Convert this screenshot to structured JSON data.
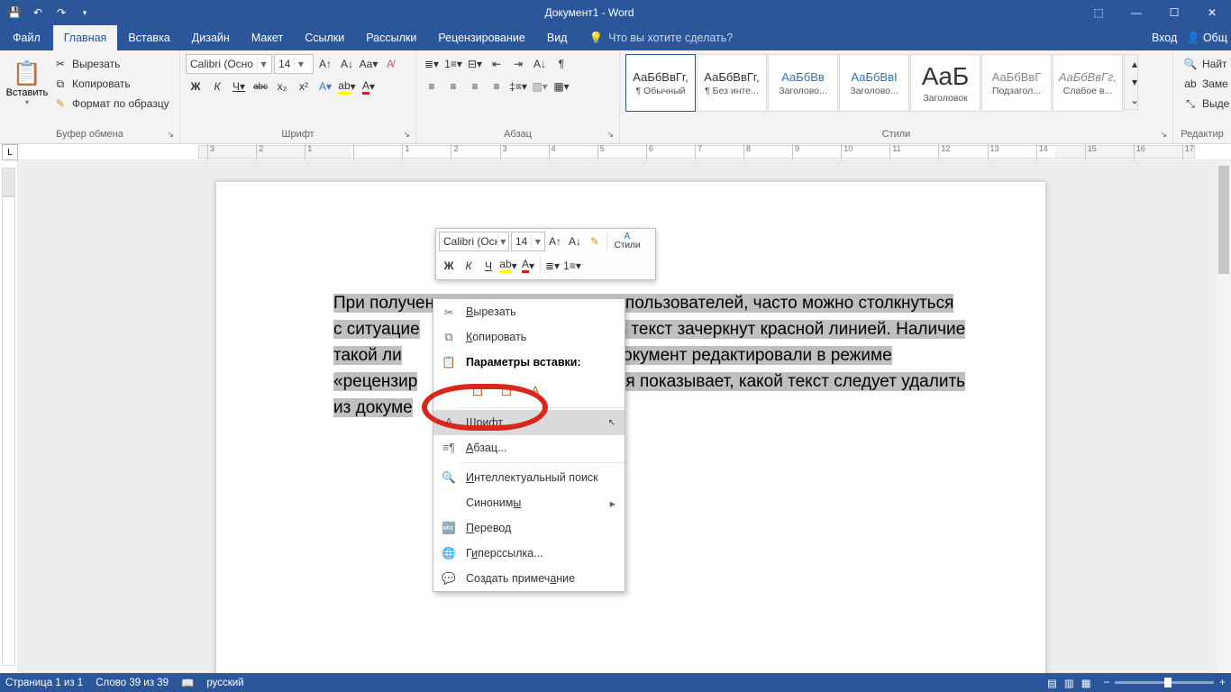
{
  "app": {
    "title": "Документ1 - Word"
  },
  "window_buttons": {
    "ribbon_opts": "⬚",
    "min": "—",
    "max": "☐",
    "close": "✕"
  },
  "menu": {
    "file": "Файл",
    "tabs": [
      "Главная",
      "Вставка",
      "Дизайн",
      "Макет",
      "Ссылки",
      "Рассылки",
      "Рецензирование",
      "Вид"
    ],
    "active": "Главная",
    "tellme_placeholder": "Что вы хотите сделать?",
    "signin": "Вход",
    "share": "Общ"
  },
  "ribbon": {
    "clipboard": {
      "paste": "Вставить",
      "cut": "Вырезать",
      "copy": "Копировать",
      "format_painter": "Формат по образцу",
      "label": "Буфер обмена"
    },
    "font": {
      "name": "Calibri (Осно",
      "size": "14",
      "bold": "Ж",
      "italic": "К",
      "underline": "Ч",
      "strike": "abc",
      "sub": "x₂",
      "sup": "x²",
      "label": "Шрифт"
    },
    "paragraph": {
      "label": "Абзац"
    },
    "styles": {
      "label": "Стили",
      "items": [
        {
          "preview": "АаБбВвГг,",
          "name": "¶ Обычный"
        },
        {
          "preview": "АаБбВвГг,",
          "name": "¶ Без инте..."
        },
        {
          "preview": "АаБбВв",
          "name": "Заголово...",
          "accent": true
        },
        {
          "preview": "АаБбВвI",
          "name": "Заголово...",
          "accent": true
        },
        {
          "preview": "АaБ",
          "name": "Заголовок",
          "big": true
        },
        {
          "preview": "АаБбВвГ",
          "name": "Подзагол...",
          "gray": true
        },
        {
          "preview": "АаБбВвГг,",
          "name": "Слабое в...",
          "gray": true
        }
      ]
    },
    "editing": {
      "find": "Найт",
      "replace": "Заме",
      "select": "Выде",
      "label": "Редактир"
    }
  },
  "ruler": {
    "marks": [
      "3",
      "2",
      "1",
      "",
      "1",
      "2",
      "3",
      "4",
      "5",
      "6",
      "7",
      "8",
      "9",
      "10",
      "11",
      "12",
      "13",
      "14",
      "15",
      "16",
      "17"
    ]
  },
  "document": {
    "lines": [
      {
        "pre": "",
        "sel": "При получении документа от других пользователей, часто можно столкнуться"
      },
      {
        "pre": "",
        "sel_left": "с ситуацие",
        "sel_right": "сь текст зачеркнут красной линией. Наличие"
      },
      {
        "pre": "",
        "sel_left": "такой    ли",
        "sel_right": "то    документ    редактировали    в    режиме"
      },
      {
        "pre": "",
        "sel_left": "«рецензир",
        "sel_right": "ния показывает, какой текст следует удалить"
      },
      {
        "pre": "",
        "sel": "из докуме"
      }
    ]
  },
  "minitoolbar": {
    "font": "Calibri (Осн",
    "size": "14",
    "styles": "Стили"
  },
  "context_menu": {
    "cut": "Вырезать",
    "copy": "Копировать",
    "paste_header": "Параметры вставки:",
    "font": "Шрифт...",
    "paragraph": "Абзац...",
    "smart_lookup": "Интеллектуальный поиск",
    "synonyms": "Синонимы",
    "translate": "Перевод",
    "hyperlink": "Гиперссылка...",
    "new_comment": "Создать примечание"
  },
  "statusbar": {
    "page": "Страница 1 из 1",
    "words": "Слово 39 из 39",
    "lang": "русский",
    "zoom": "100"
  }
}
